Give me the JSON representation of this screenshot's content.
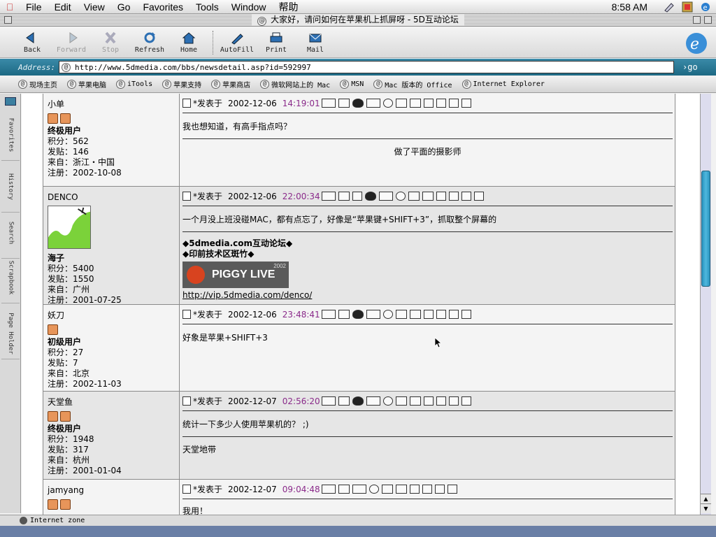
{
  "menubar": {
    "items": [
      "File",
      "Edit",
      "View",
      "Go",
      "Favorites",
      "Tools",
      "Window",
      "帮助"
    ],
    "clock": "8:58 AM"
  },
  "window": {
    "title": "大家好，请问如何在苹果机上抓屏呀 - 5D互动论坛"
  },
  "toolbar": {
    "buttons": [
      {
        "label": "Back",
        "icon": "back-arrow-icon",
        "enabled": true
      },
      {
        "label": "Forward",
        "icon": "forward-arrow-icon",
        "enabled": false
      },
      {
        "label": "Stop",
        "icon": "stop-x-icon",
        "enabled": false
      },
      {
        "label": "Refresh",
        "icon": "refresh-icon",
        "enabled": true
      },
      {
        "label": "Home",
        "icon": "home-icon",
        "enabled": true
      },
      {
        "label": "AutoFill",
        "icon": "autofill-icon",
        "enabled": true
      },
      {
        "label": "Print",
        "icon": "print-icon",
        "enabled": true
      },
      {
        "label": "Mail",
        "icon": "mail-icon",
        "enabled": true
      }
    ]
  },
  "address": {
    "label": "Address:",
    "url": "http://www.5dmedia.com/bbs/newsdetail.asp?id=592997",
    "go": "go"
  },
  "favorites_bar": {
    "items": [
      "现场主页",
      "苹果电脑",
      "iTools",
      "苹果支持",
      "苹果商店",
      "微软网站上的 Mac",
      "MSN",
      "Mac 版本的 Office",
      "Internet Explorer"
    ]
  },
  "side_tabs": [
    "Favorites",
    "History",
    "Search",
    "Scrapbook",
    "Page Holder"
  ],
  "posts": [
    {
      "user": "小单",
      "badges": 2,
      "rank": "终极用户",
      "points": "积分：562",
      "posts": "发贴：146",
      "from": "来自：浙江・中国",
      "reg": "注册：2002-10-08",
      "posted_label": "发表于",
      "date": "2002-12-06",
      "time": "14:19:01",
      "text": "我也想知道，有高手指点吗？",
      "sig": "做了平面的摄影师"
    },
    {
      "user": "DENCO",
      "badges": 0,
      "rank": "海子",
      "points": "积分：5400",
      "posts": "发贴：1550",
      "from": "来自：广州",
      "reg": "注册：2001-07-25",
      "posted_label": "发表于",
      "date": "2002-12-06",
      "time": "22:00:34",
      "text": "一个月没上班没碰MAC，都有点忘了，好像是“苹果键+SHIFT+3”，抓取整个屏幕的",
      "sig_line1": "◆5dmedia.com互动论坛◆",
      "sig_line2": "◆印前技术区斑竹◆",
      "banner_text": "PIGGY LIVE",
      "banner_year": "2002",
      "sig_link": "http://vip.5dmedia.com/denco/"
    },
    {
      "user": "妖刀",
      "badges": 1,
      "rank": "初级用户",
      "points": "积分：27",
      "posts": "发贴：7",
      "from": "来自：北京",
      "reg": "注册：2002-11-03",
      "posted_label": "发表于",
      "date": "2002-12-06",
      "time": "23:48:41",
      "text": "好象是苹果+SHIFT+3"
    },
    {
      "user": "天堂鱼",
      "badges": 2,
      "rank": "终极用户",
      "points": "积分：1948",
      "posts": "发贴：317",
      "from": "来自：杭州",
      "reg": "注册：2001-01-04",
      "posted_label": "发表于",
      "date": "2002-12-07",
      "time": "02:56:20",
      "text": "统计一下多少人使用苹果机的？ ;)",
      "sig": "天堂地带"
    },
    {
      "user": "jamyang",
      "badges": 2,
      "rank": "",
      "points": "",
      "posts": "",
      "from": "",
      "reg": "",
      "posted_label": "发表于",
      "date": "2002-12-07",
      "time": "09:04:48",
      "text": "我用！"
    }
  ],
  "status": {
    "zone": "Internet zone"
  },
  "colors": {
    "time": "#8a2a8a",
    "address_bar": "#1d6984",
    "scroll_thumb": "#3aa7d0"
  }
}
